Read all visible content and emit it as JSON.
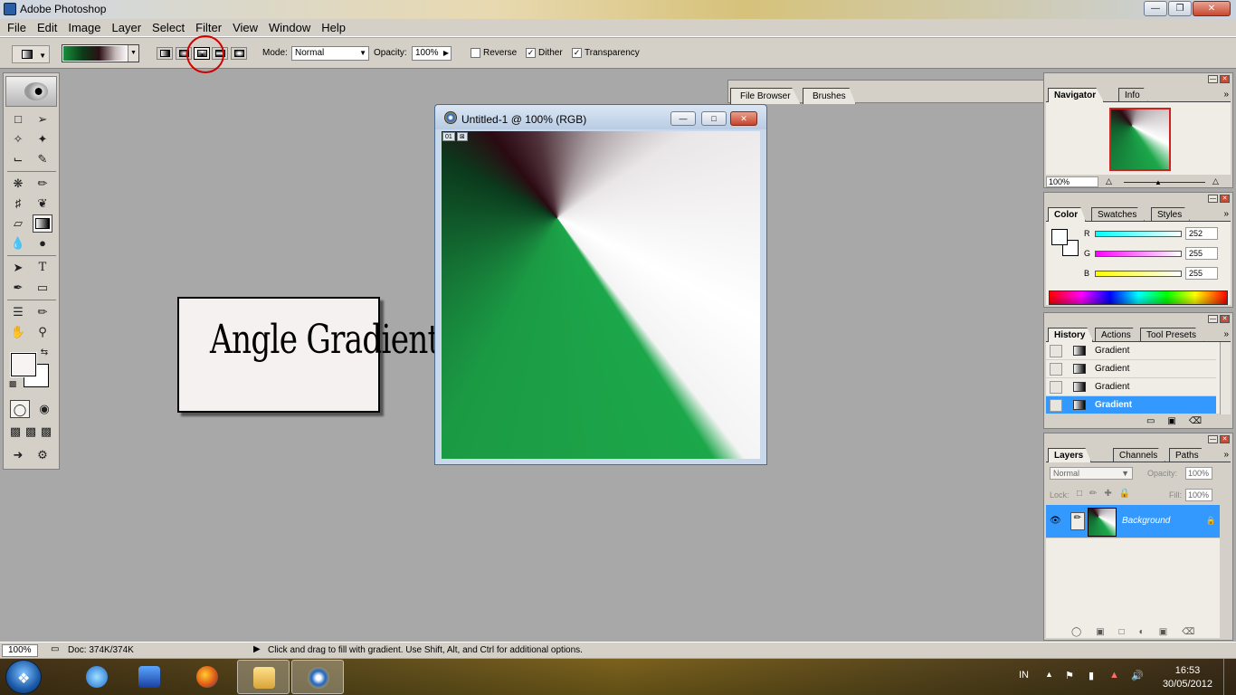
{
  "window": {
    "title": "Adobe Photoshop"
  },
  "menu": [
    "File",
    "Edit",
    "Image",
    "Layer",
    "Select",
    "Filter",
    "View",
    "Window",
    "Help"
  ],
  "options": {
    "mode_label": "Mode:",
    "mode_value": "Normal",
    "opacity_label": "Opacity:",
    "opacity_value": "100%",
    "reverse": "Reverse",
    "dither": "Dither",
    "transparency": "Transparency",
    "palette_well_tabs": [
      "File Browser",
      "Brushes"
    ]
  },
  "annotation": {
    "text": "Angle Gradient"
  },
  "document": {
    "title": "Untitled-1 @ 100% (RGB)",
    "tags": [
      "01",
      "⊠"
    ]
  },
  "navigator": {
    "tabs": [
      "Navigator",
      "Info"
    ],
    "zoom": "100%"
  },
  "color": {
    "tabs": [
      "Color",
      "Swatches",
      "Styles"
    ],
    "r_label": "R",
    "g_label": "G",
    "b_label": "B",
    "r": "252",
    "g": "255",
    "b": "255"
  },
  "history": {
    "tabs": [
      "History",
      "Actions",
      "Tool Presets"
    ],
    "items": [
      "Gradient",
      "Gradient",
      "Gradient",
      "Gradient"
    ]
  },
  "layers": {
    "tabs": [
      "Layers",
      "Channels",
      "Paths"
    ],
    "blend": "Normal",
    "opacity_label": "Opacity:",
    "opacity": "100%",
    "lock_label": "Lock:",
    "fill_label": "Fill:",
    "fill": "100%",
    "layer_name": "Background"
  },
  "status": {
    "zoom": "100%",
    "doc": "Doc: 374K/374K",
    "hint": "Click and drag to fill with gradient.  Use Shift, Alt, and Ctrl for additional options."
  },
  "taskbar": {
    "lang": "IN",
    "time": "16:53",
    "date": "30/05/2012",
    "apps": [
      "internet-explorer",
      "media-player",
      "firefox",
      "file-explorer",
      "photoshop"
    ]
  },
  "colors": {
    "accent": "#3399ff",
    "canvas_green": "#1ca74a"
  }
}
